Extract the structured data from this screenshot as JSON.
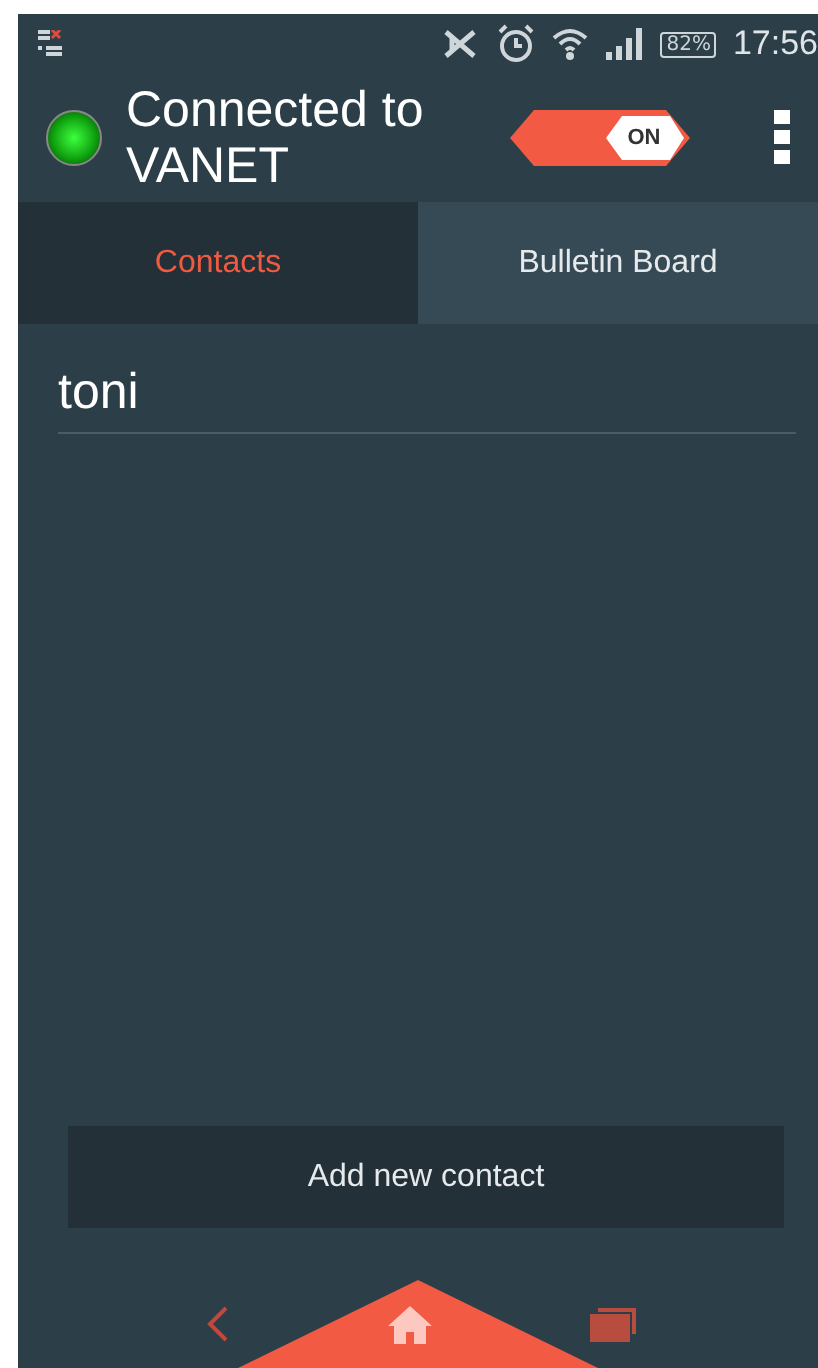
{
  "status_bar": {
    "battery": "82%",
    "time": "17:56"
  },
  "header": {
    "connected": true,
    "title": "Connected to VANET",
    "toggle": {
      "label": "ON",
      "on": true
    }
  },
  "tabs": [
    {
      "label": "Contacts",
      "selected": true
    },
    {
      "label": "Bulletin Board",
      "selected": false
    }
  ],
  "contacts": [
    {
      "name": "toni"
    }
  ],
  "add_button": "Add new contact"
}
